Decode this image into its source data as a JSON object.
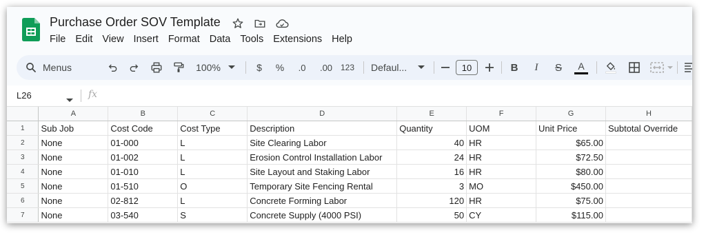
{
  "doc": {
    "title": "Purchase Order SOV Template"
  },
  "menu": [
    "File",
    "Edit",
    "View",
    "Insert",
    "Format",
    "Data",
    "Tools",
    "Extensions",
    "Help"
  ],
  "toolbar": {
    "search_label": "Menus",
    "zoom": "100%",
    "currency": "$",
    "percent": "%",
    "dec_decrease": ".0",
    "dec_increase": ".00",
    "number_format": "123",
    "font": "Defaul...",
    "font_size": "10",
    "bold": "B",
    "italic": "I",
    "strike": "S",
    "text_color": "A"
  },
  "formula_bar": {
    "cell_ref": "L26",
    "fx": "fx"
  },
  "colors": {
    "sheets_green": "#0f9d58",
    "toolbar_bg": "#edf2fa"
  },
  "sheet": {
    "column_letters": [
      "A",
      "B",
      "C",
      "D",
      "E",
      "F",
      "G",
      "H"
    ],
    "rows": [
      {
        "n": "1",
        "cells": [
          "Sub Job",
          "Cost Code",
          "Cost Type",
          "Description",
          "Quantity",
          "UOM",
          "Unit Price",
          "Subtotal Override"
        ]
      },
      {
        "n": "2",
        "cells": [
          "None",
          "01-000",
          "L",
          "Site Clearing Labor",
          "40",
          "HR",
          "$65.00",
          ""
        ]
      },
      {
        "n": "3",
        "cells": [
          "None",
          "01-002",
          "L",
          "Erosion Control Installation Labor",
          "24",
          "HR",
          "$72.50",
          ""
        ]
      },
      {
        "n": "4",
        "cells": [
          "None",
          "01-010",
          "L",
          "Site Layout and Staking Labor",
          "16",
          "HR",
          "$80.00",
          ""
        ]
      },
      {
        "n": "5",
        "cells": [
          "None",
          "01-510",
          "O",
          "Temporary Site Fencing Rental",
          "3",
          "MO",
          "$450.00",
          ""
        ]
      },
      {
        "n": "6",
        "cells": [
          "None",
          "02-812",
          "L",
          "Concrete Forming Labor",
          "120",
          "HR",
          "$75.00",
          ""
        ]
      },
      {
        "n": "7",
        "cells": [
          "None",
          "03-540",
          "S",
          "Concrete Supply (4000 PSI)",
          "50",
          "CY",
          "$115.00",
          ""
        ]
      }
    ]
  }
}
